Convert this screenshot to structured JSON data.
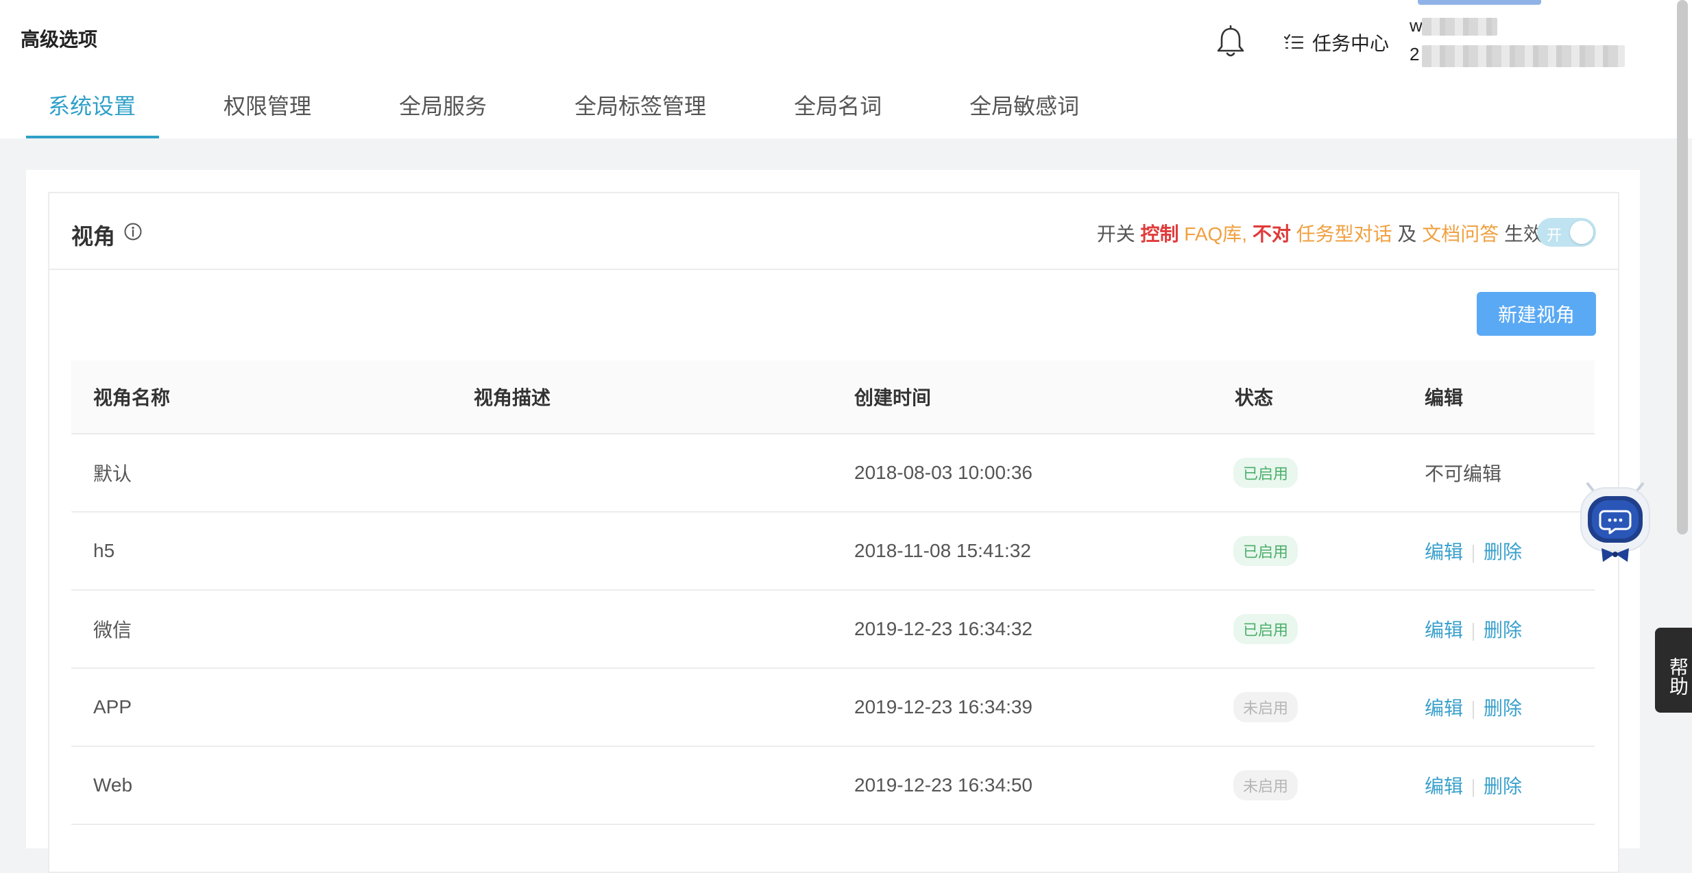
{
  "header": {
    "title": "高级选项",
    "task_center_label": "任务中心",
    "user_initial_top": "w",
    "user_initial_bottom": "2"
  },
  "tabs": [
    {
      "label": "系统设置",
      "active": true
    },
    {
      "label": "权限管理",
      "active": false
    },
    {
      "label": "全局服务",
      "active": false
    },
    {
      "label": "全局标签管理",
      "active": false
    },
    {
      "label": "全局名词",
      "active": false
    },
    {
      "label": "全局敏感词",
      "active": false
    }
  ],
  "section": {
    "title": "视角",
    "note_parts": [
      "开关 ",
      "控制",
      " FAQ库,",
      " 不对 ",
      "任务型对话",
      " 及 ",
      "文档问答",
      " 生效"
    ],
    "toggle_label": "开",
    "toggle_on": true,
    "new_button_label": "新建视角"
  },
  "table": {
    "headers": [
      "视角名称",
      "视角描述",
      "创建时间",
      "状态",
      "编辑"
    ],
    "rows": [
      {
        "name": "默认",
        "desc": "",
        "created": "2018-08-03 10:00:36",
        "status": "已启用",
        "enabled": true,
        "editable": false,
        "edit_text": "不可编辑"
      },
      {
        "name": "h5",
        "desc": "",
        "created": "2018-11-08 15:41:32",
        "status": "已启用",
        "enabled": true,
        "editable": true
      },
      {
        "name": "微信",
        "desc": "",
        "created": "2019-12-23 16:34:32",
        "status": "已启用",
        "enabled": true,
        "editable": true
      },
      {
        "name": "APP",
        "desc": "",
        "created": "2019-12-23 16:34:39",
        "status": "未启用",
        "enabled": false,
        "editable": true
      },
      {
        "name": "Web",
        "desc": "",
        "created": "2019-12-23 16:34:50",
        "status": "未启用",
        "enabled": false,
        "editable": true
      }
    ],
    "edit_label": "编辑",
    "delete_label": "删除"
  },
  "help_label": "帮助",
  "colors": {
    "accent": "#2fa0c8",
    "primary_button": "#5aa9f4",
    "enabled_text": "#4caf6a",
    "disabled_text": "#b5b5b5",
    "warning_red": "#e03a3a",
    "note_orange": "#f0a040"
  },
  "icons": {
    "bell": "bell-icon",
    "task_list": "task-list-icon",
    "info": "info-icon",
    "robot": "robot-assistant-icon"
  }
}
